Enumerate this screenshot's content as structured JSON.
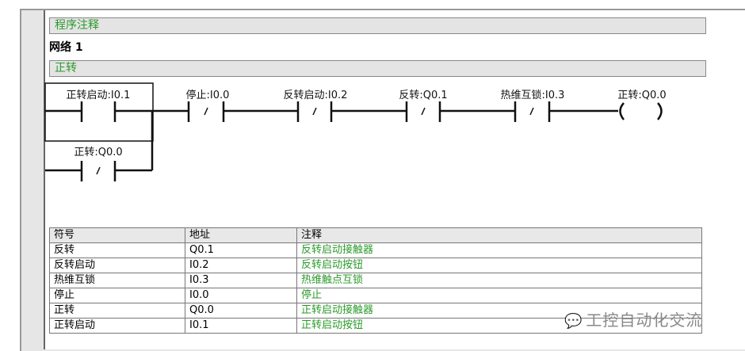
{
  "program_comment": "程序注释",
  "network": {
    "title": "网络 1",
    "comment": "正转",
    "contacts": [
      {
        "label": "正转启动:I0.1",
        "type": "NO"
      },
      {
        "label": "正转:Q0.0",
        "type": "NC"
      },
      {
        "label": "停止:I0.0",
        "type": "NC"
      },
      {
        "label": "反转启动:I0.2",
        "type": "NC"
      },
      {
        "label": "反转:Q0.1",
        "type": "NC"
      },
      {
        "label": "热维互锁:I0.3",
        "type": "NC"
      }
    ],
    "coil": {
      "label": "正转:Q0.0"
    }
  },
  "symbol_table": {
    "headers": [
      "符号",
      "地址",
      "注释"
    ],
    "rows": [
      [
        "反转",
        "Q0.1",
        "反转启动接触器"
      ],
      [
        "反转启动",
        "I0.2",
        "反转启动按钮"
      ],
      [
        "热维互锁",
        "I0.3",
        "热维触点互锁"
      ],
      [
        "停止",
        "I0.0",
        "停止"
      ],
      [
        "正转",
        "Q0.0",
        "正转启动接触器"
      ],
      [
        "正转启动",
        "I0.1",
        "正转启动按钮"
      ]
    ]
  },
  "watermark": "工控自动化交流"
}
